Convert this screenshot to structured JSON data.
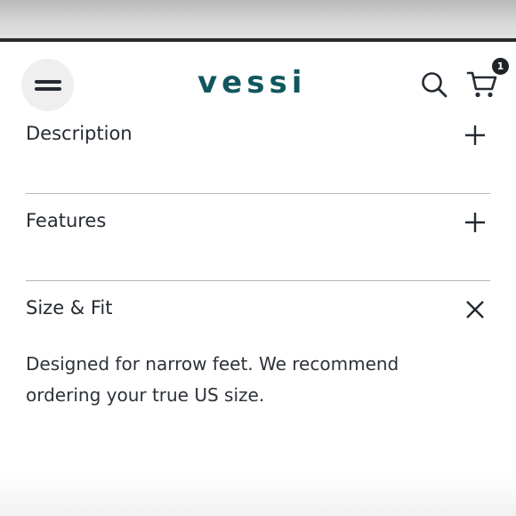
{
  "header": {
    "brand": "vessi",
    "cart_count": "1",
    "icons": {
      "menu": "hamburger-icon",
      "search": "search-icon",
      "cart": "cart-icon"
    }
  },
  "accordion": [
    {
      "title": "Description",
      "state": "collapsed",
      "toggle_icon": "plus-icon"
    },
    {
      "title": "Features",
      "state": "collapsed",
      "toggle_icon": "plus-icon"
    },
    {
      "title": "Size & Fit",
      "state": "expanded",
      "toggle_icon": "close-icon",
      "content": "Designed for narrow feet. We recommend ordering your true US size."
    }
  ],
  "colors": {
    "brand": "#11565e",
    "text": "#262b33",
    "divider": "#b5b5b5",
    "badge": "#1f2226"
  }
}
